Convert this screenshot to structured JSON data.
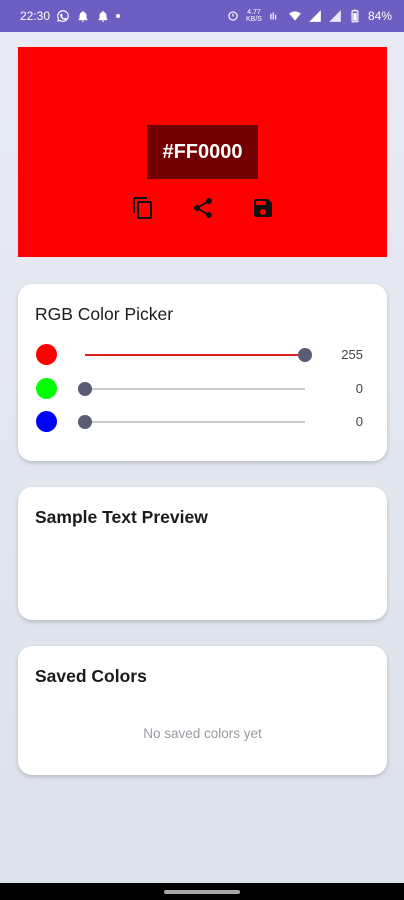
{
  "status_bar": {
    "time": "22:30",
    "network_speed_value": "4.77",
    "network_speed_unit": "KB/S",
    "battery": "84%"
  },
  "preview": {
    "color": "#FF0000",
    "hex_label": "#FF0000",
    "actions": [
      "copy-icon",
      "share-icon",
      "save-icon"
    ]
  },
  "rgb_picker": {
    "title": "RGB Color Picker",
    "sliders": [
      {
        "channel": "red",
        "swatch_color": "#ff0000",
        "fill_color": "#e02020",
        "value": 255,
        "max": 255
      },
      {
        "channel": "green",
        "swatch_color": "#00ff00",
        "fill_color": "#5a5c74",
        "value": 0,
        "max": 255
      },
      {
        "channel": "blue",
        "swatch_color": "#0000ff",
        "fill_color": "#5a5c74",
        "value": 0,
        "max": 255
      }
    ]
  },
  "text_preview": {
    "title": "Sample Text Preview"
  },
  "saved_colors": {
    "title": "Saved Colors",
    "empty_message": "No saved colors yet"
  },
  "colors": {
    "status_bar": "#6d5fc2",
    "thumb": "#5a5c74"
  }
}
